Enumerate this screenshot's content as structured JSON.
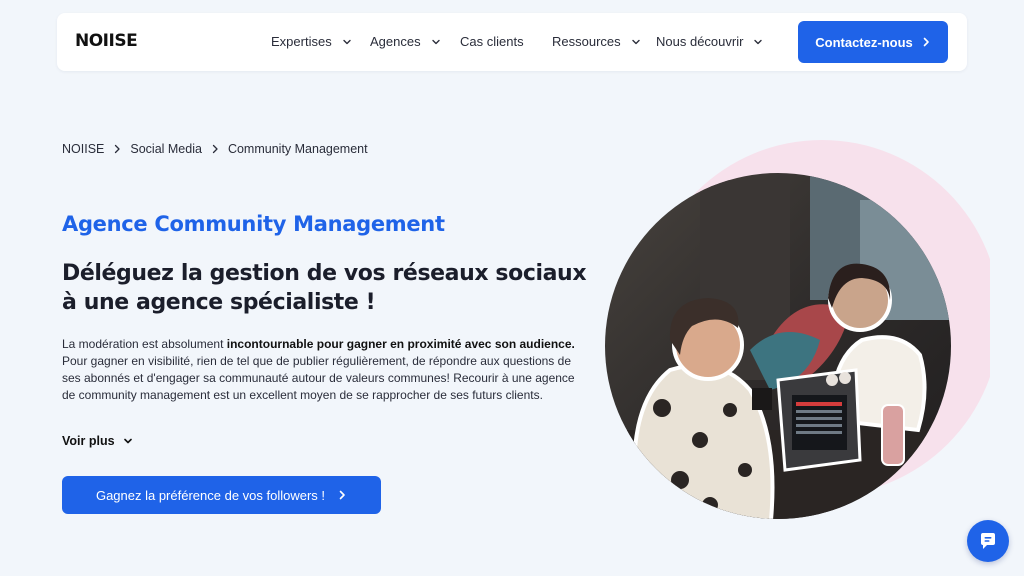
{
  "brand": {
    "logo_text": "NOIISE"
  },
  "nav": {
    "items": [
      {
        "label": "Expertises",
        "has_dropdown": true
      },
      {
        "label": "Agences",
        "has_dropdown": true
      },
      {
        "label": "Cas clients",
        "has_dropdown": false
      },
      {
        "label": "Ressources",
        "has_dropdown": true
      },
      {
        "label": "Nous découvrir",
        "has_dropdown": true
      }
    ],
    "cta_label": "Contactez-nous"
  },
  "breadcrumb": [
    "NOIISE",
    "Social Media",
    "Community Management"
  ],
  "hero": {
    "eyebrow": "Agence Community Management",
    "headline_line1": "Déléguez la gestion de vos réseaux sociaux",
    "headline_line2": "à une agence spécialiste !",
    "body_part1": "La modération est absolument ",
    "body_bold": "incontournable pour gagner en proximité avec son audience.",
    "body_part2": " Pour gagner en visibilité, rien de tel que de publier régulièrement, de répondre aux questions de ses abonnés et d'engager sa communauté autour de valeurs communes! Recourir à une agence de community management est un excellent moyen de se rapprocher de ses futurs clients.",
    "read_more_label": "Voir plus",
    "button_label": "Gagnez la préférence de vos followers !",
    "image_icon": "team-photo-illustration"
  },
  "icons": {
    "dropdown": "chevron-down-icon",
    "arrow": "chevron-right-icon",
    "chat": "chat-bubble-icon"
  },
  "colors": {
    "accent": "#1f63e8",
    "background": "#f2f6fb",
    "blob": "#f7e1ec"
  }
}
